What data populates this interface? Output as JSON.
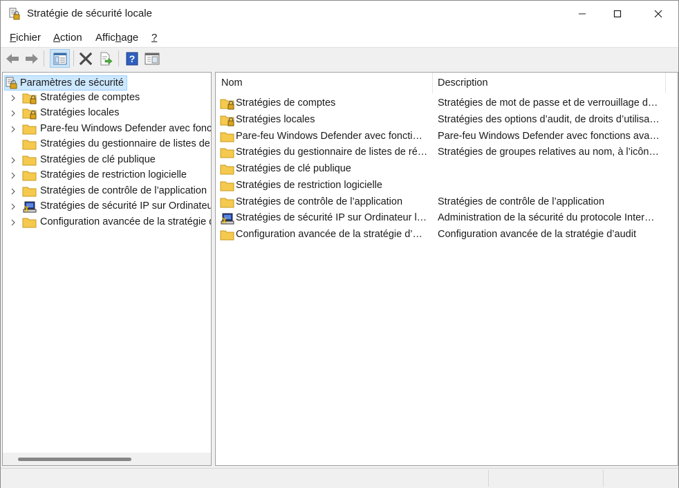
{
  "window": {
    "title": "Stratégie de sécurité locale"
  },
  "menu": {
    "items": [
      {
        "u": "F",
        "rest": "ichier"
      },
      {
        "u": "A",
        "rest": "ction"
      },
      {
        "pre": "Affic",
        "u": "h",
        "rest": "age"
      },
      {
        "u": "?",
        "rest": ""
      }
    ]
  },
  "toolbar": {
    "icons": [
      "back-arrow-icon",
      "forward-arrow-icon",
      "show-hide-console-tree-icon",
      "delete-icon",
      "export-list-icon",
      "help-icon",
      "properties-view-icon"
    ]
  },
  "tree": {
    "root": "Paramètres de sécurité",
    "items": [
      {
        "label": "Stratégies de comptes",
        "icon": "locked-folder-icon",
        "expandable": true
      },
      {
        "label": "Stratégies locales",
        "icon": "locked-folder-icon",
        "expandable": true
      },
      {
        "label": "Pare-feu Windows Defender avec fonctions avancées de sécurité",
        "icon": "folder-icon",
        "expandable": true
      },
      {
        "label": "Stratégies du gestionnaire de listes de réseaux",
        "icon": "folder-icon",
        "expandable": false
      },
      {
        "label": "Stratégies de clé publique",
        "icon": "folder-icon",
        "expandable": true
      },
      {
        "label": "Stratégies de restriction logicielle",
        "icon": "folder-icon",
        "expandable": true
      },
      {
        "label": "Stratégies de contrôle de l’application",
        "icon": "folder-icon",
        "expandable": true
      },
      {
        "label": "Stratégies de sécurité IP sur Ordinateur local",
        "icon": "ipsec-computer-icon",
        "expandable": true
      },
      {
        "label": "Configuration avancée de la stratégie d’audit",
        "icon": "folder-icon",
        "expandable": true
      }
    ]
  },
  "list": {
    "columns": [
      "Nom",
      "Description"
    ],
    "rows": [
      {
        "name": "Stratégies de comptes",
        "desc": "Stratégies de mot de passe et de verrouillage de…",
        "icon": "locked-folder-icon"
      },
      {
        "name": "Stratégies locales",
        "desc": "Stratégies des options d’audit, de droits d’utilisa…",
        "icon": "locked-folder-icon"
      },
      {
        "name": "Pare-feu Windows Defender avec fonctio…",
        "desc": "Pare-feu Windows Defender avec fonctions ava…",
        "icon": "folder-icon"
      },
      {
        "name": "Stratégies du gestionnaire de listes de rés…",
        "desc": "Stratégies de groupes relatives au nom, à l’icône…",
        "icon": "folder-icon"
      },
      {
        "name": "Stratégies de clé publique",
        "desc": "",
        "icon": "folder-icon"
      },
      {
        "name": "Stratégies de restriction logicielle",
        "desc": "",
        "icon": "folder-icon"
      },
      {
        "name": "Stratégies de contrôle de l’application",
        "desc": "Stratégies de contrôle de l’application",
        "icon": "folder-icon"
      },
      {
        "name": "Stratégies de sécurité IP sur Ordinateur lo…",
        "desc": "Administration de la sécurité du protocole Inter…",
        "icon": "ipsec-computer-icon"
      },
      {
        "name": "Configuration avancée de la stratégie d’a…",
        "desc": "Configuration avancée de la stratégie d’audit",
        "icon": "folder-icon"
      }
    ]
  },
  "colors": {
    "selection_bg": "#cce8ff",
    "selection_border": "#99d1ff",
    "folder": "#f5c94e",
    "toolbar_active": "#cce4f7"
  }
}
